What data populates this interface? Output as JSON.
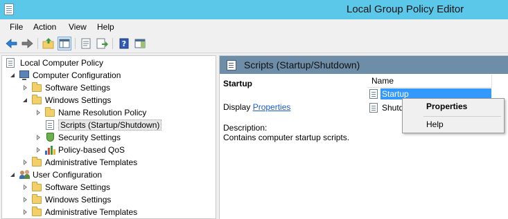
{
  "window": {
    "title": "Local Group Policy Editor"
  },
  "menu": {
    "items": [
      "File",
      "Action",
      "View",
      "Help"
    ]
  },
  "toolbar": {
    "buttons": [
      "back-icon",
      "forward-icon",
      "up-folder-icon",
      "show-hide-tree-icon",
      "properties-icon",
      "export-list-icon",
      "help-icon",
      "show-hide-action-pane-icon"
    ]
  },
  "tree": {
    "root": "Local Computer Policy",
    "computer_config": "Computer Configuration",
    "software_settings": "Software Settings",
    "windows_settings": "Windows Settings",
    "name_resolution": "Name Resolution Policy",
    "scripts": "Scripts (Startup/Shutdown)",
    "security_settings": "Security Settings",
    "qos": "Policy-based QoS",
    "admin_templates": "Administrative Templates",
    "user_config": "User Configuration",
    "user_software_settings": "Software Settings",
    "user_windows_settings": "Windows Settings",
    "user_admin_templates": "Administrative Templates"
  },
  "detail": {
    "header_title": "Scripts (Startup/Shutdown)",
    "item_title": "Startup",
    "display_prefix": "Display ",
    "display_link": "Properties",
    "description_label": "Description:",
    "description_text": "Contains computer startup scripts."
  },
  "list": {
    "column_name": "Name",
    "items": [
      "Startup",
      "Shutd"
    ]
  },
  "context_menu": {
    "properties": "Properties",
    "help": "Help"
  },
  "colors": {
    "titlebar": "#5bc8ea",
    "header_bar": "#6d8da8",
    "selection": "#3399ff",
    "link": "#1a5cc9"
  }
}
